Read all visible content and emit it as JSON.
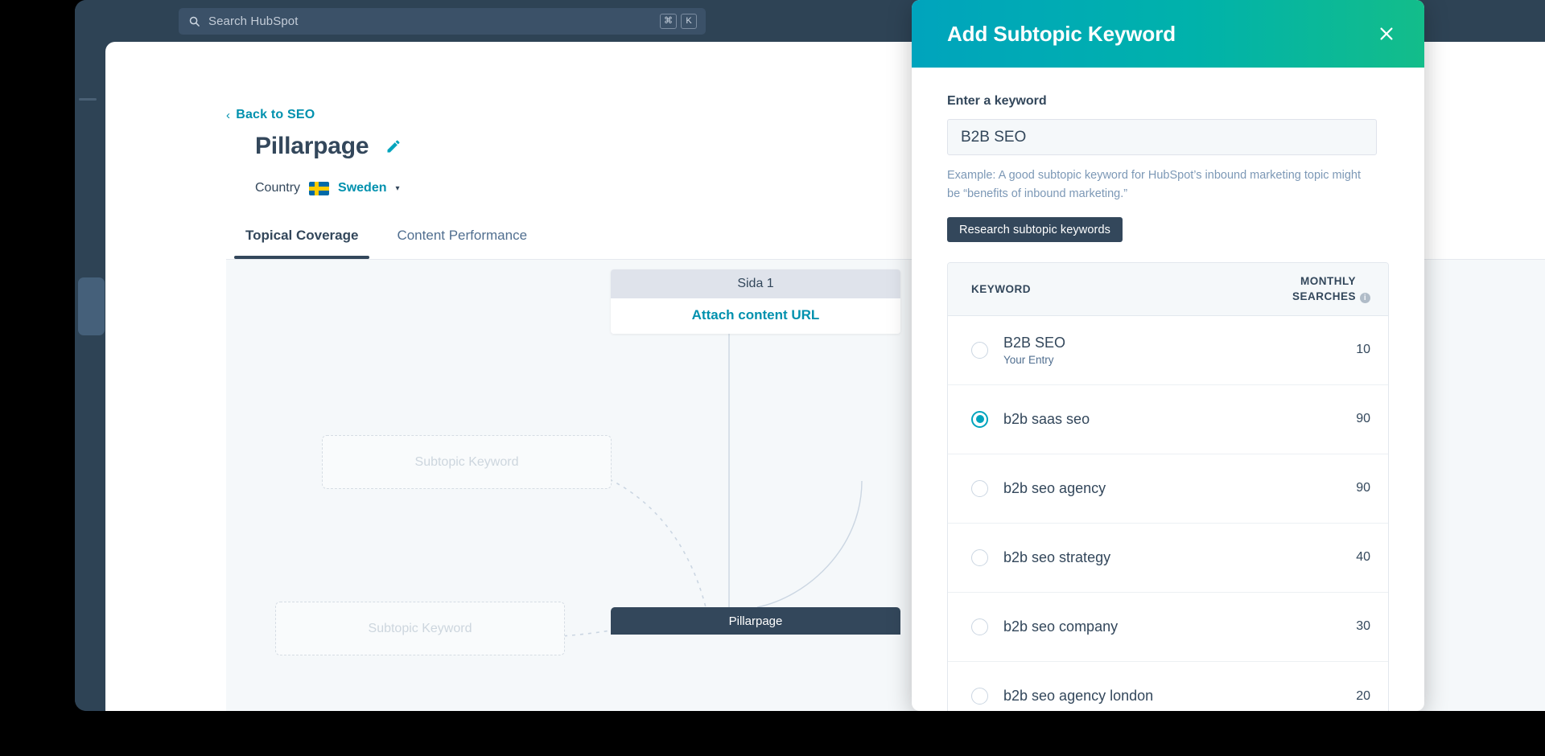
{
  "app": {
    "search": {
      "placeholder": "Search HubSpot",
      "icon": "search-icon",
      "shortcut_keys": [
        "⌘",
        "K"
      ]
    }
  },
  "page": {
    "back_link": "Back to SEO",
    "back_chevron": "‹",
    "title": "Pillarpage",
    "edit_icon": "pencil-icon",
    "country_label": "Country",
    "country_value": "Sweden",
    "country_flag": "flag-sweden-icon",
    "country_caret": "▾",
    "tabs": [
      {
        "label": "Topical Coverage",
        "active": true
      },
      {
        "label": "Content Performance",
        "active": false
      }
    ]
  },
  "graph": {
    "page_node": {
      "header": "Sida 1",
      "action": "Attach content URL"
    },
    "ghost_node_1": "Subtopic Keyword",
    "ghost_node_2": "Subtopic Keyword",
    "pillar_node": "Pillarpage"
  },
  "modal": {
    "title": "Add Subtopic Keyword",
    "close_icon": "close-icon",
    "header_gradient_from": "#00a4bd",
    "header_gradient_to": "#13bd8a",
    "keyword_label": "Enter a keyword",
    "keyword_value": "B2B SEO",
    "keyword_placeholder": "Enter a keyword",
    "hint": "Example: A good subtopic keyword for HubSpot’s inbound marketing topic might be “benefits of inbound marketing.”",
    "research_button": "Research subtopic keywords",
    "table": {
      "col_keyword": "KEYWORD",
      "col_monthly": "MONTHLY SEARCHES",
      "col_monthly_line1": "MONTHLY",
      "col_monthly_line2": "SEARCHES",
      "info_icon": "info-icon",
      "rows": [
        {
          "keyword": "B2B SEO",
          "sub": "Your Entry",
          "searches": "10",
          "selected": false
        },
        {
          "keyword": "b2b saas seo",
          "sub": "",
          "searches": "90",
          "selected": true
        },
        {
          "keyword": "b2b seo agency",
          "sub": "",
          "searches": "90",
          "selected": false
        },
        {
          "keyword": "b2b seo strategy",
          "sub": "",
          "searches": "40",
          "selected": false
        },
        {
          "keyword": "b2b seo company",
          "sub": "",
          "searches": "30",
          "selected": false
        },
        {
          "keyword": "b2b seo agency london",
          "sub": "",
          "searches": "20",
          "selected": false
        }
      ]
    },
    "accent_color": "#00a4bd",
    "button_color": "#33475b"
  }
}
